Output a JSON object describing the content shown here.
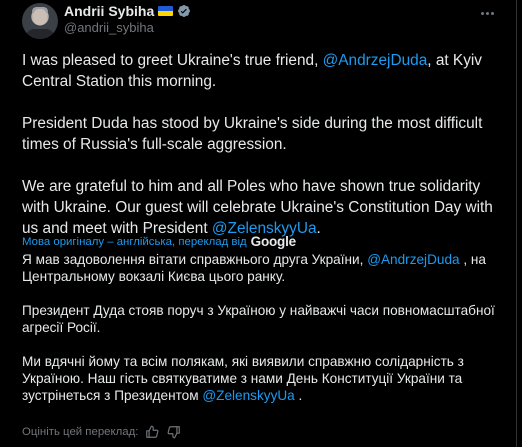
{
  "author": {
    "display_name": "Andrii Sybiha",
    "handle": "@andrii_sybiha",
    "flag_icon": "ukraine-flag-icon",
    "verified_icon": "verified-badge-icon"
  },
  "tweet": {
    "paragraphs": [
      [
        {
          "text": "I was pleased to greet Ukraine's true friend, ",
          "mention": false
        },
        {
          "text": "@AndrzejDuda",
          "mention": true
        },
        {
          "text": ", at Kyiv Central Station this morning.",
          "mention": false
        }
      ],
      [
        {
          "text": "President Duda has stood by Ukraine's side during the most difficult times of Russia's full-scale aggression.",
          "mention": false
        }
      ],
      [
        {
          "text": "We are grateful to him and all Poles who have shown true solidarity with Ukraine. Our guest will celebrate Ukraine's Constitution Day with us and meet with President ",
          "mention": false
        },
        {
          "text": "@ZelenskyyUa",
          "mention": true
        },
        {
          "text": ".",
          "mention": false
        }
      ]
    ]
  },
  "translation_info": {
    "label": "Мова оригіналу – англійська, переклад від",
    "provider": "Google"
  },
  "translation": {
    "paragraphs": [
      [
        {
          "text": "Я мав задоволення вітати справжнього друга України, ",
          "mention": false
        },
        {
          "text": "@AndrzejDuda",
          "mention": true
        },
        {
          "text": " , на Центральному вокзалі Києва цього ранку.",
          "mention": false
        }
      ],
      [
        {
          "text": "Президент Дуда стояв поруч з Україною у найважчі часи повномасштабної агресії Росії.",
          "mention": false
        }
      ],
      [
        {
          "text": "Ми вдячні йому та всім полякам, які виявили справжню солідарність з Україною. Наш гість святкуватиме з нами День Конституції України та зустрінеться з Президентом ",
          "mention": false
        },
        {
          "text": "@ZelenskyyUa",
          "mention": true
        },
        {
          "text": " .",
          "mention": false
        }
      ]
    ]
  },
  "rate": {
    "label": "Оцініть цей переклад:",
    "up_icon": "thumbs-up-icon",
    "down_icon": "thumbs-down-icon"
  },
  "colors": {
    "background": "#000000",
    "text": "#e7e9ea",
    "secondary": "#71767b",
    "accent": "#1d9bf0"
  }
}
